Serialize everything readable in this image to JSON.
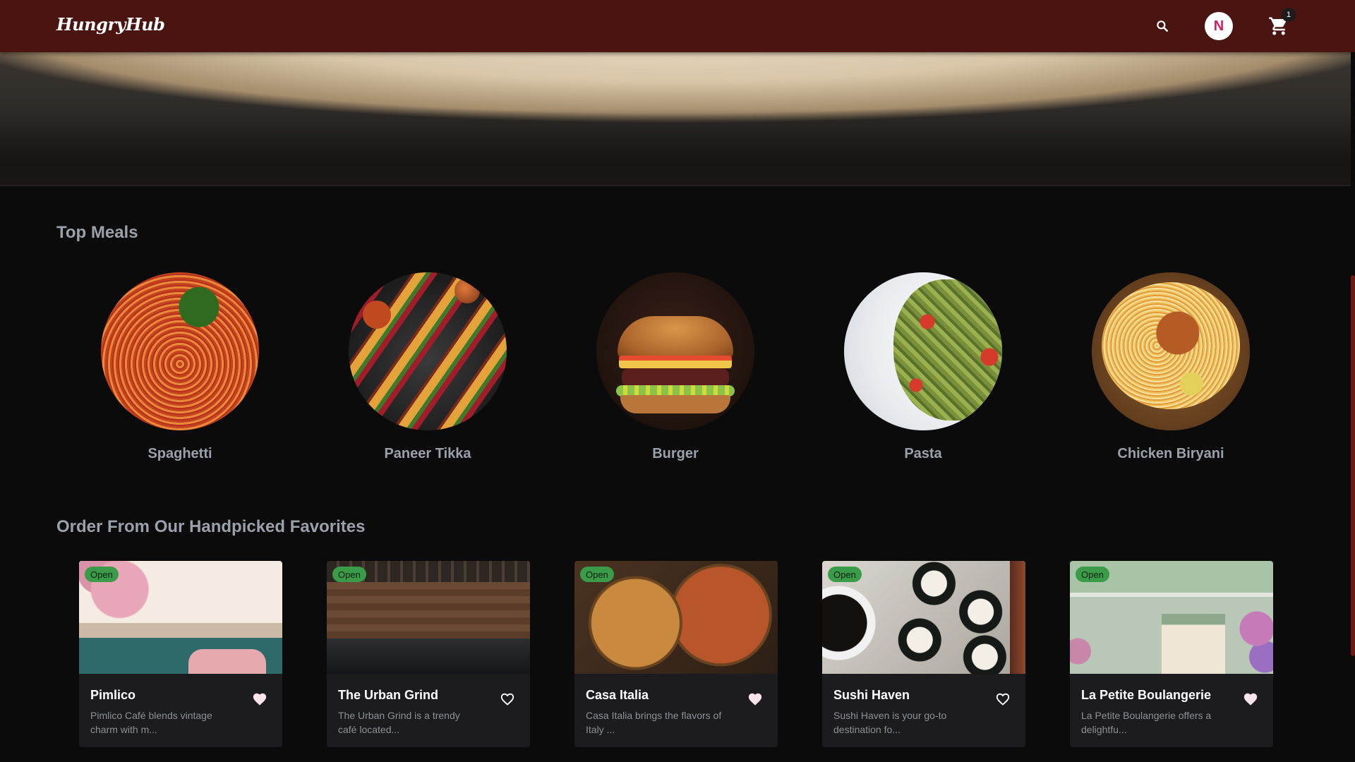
{
  "header": {
    "logo_text": "HungryHub",
    "avatar_initial": "N",
    "cart_count": "1",
    "icons": {
      "search": "search-icon",
      "cart": "cart-icon"
    },
    "colors": {
      "bar": "#4a1510",
      "avatar_text": "#d81b60"
    }
  },
  "sections": {
    "top_meals_title": "Top Meals",
    "favorites_title": "Order From Our Handpicked Favorites"
  },
  "meals": [
    {
      "name": "Spaghetti"
    },
    {
      "name": "Paneer Tikka"
    },
    {
      "name": "Burger"
    },
    {
      "name": "Pasta"
    },
    {
      "name": "Chicken Biryani"
    }
  ],
  "restaurants": [
    {
      "name": "Pimlico",
      "status": "Open",
      "description": "Pimlico Café blends vintage charm with m...",
      "favorite_icon": "heart-filled-icon"
    },
    {
      "name": "The Urban Grind",
      "status": "Open",
      "description": "The Urban Grind is a trendy café located...",
      "favorite_icon": "heart-outline-icon"
    },
    {
      "name": "Casa Italia",
      "status": "Open",
      "description": "Casa Italia brings the flavors of Italy ...",
      "favorite_icon": "heart-filled-icon"
    },
    {
      "name": "Sushi Haven",
      "status": "Open",
      "description": "Sushi Haven is your go-to destination fo...",
      "favorite_icon": "heart-outline-icon"
    },
    {
      "name": "La Petite Boulangerie",
      "status": "Open",
      "description": "La Petite Boulangerie offers a delightfu...",
      "favorite_icon": "heart-filled-icon"
    }
  ],
  "colors": {
    "page_bg": "#0b0b0c",
    "section_title": "#9aa1ab",
    "card_bg": "#1c1c1e",
    "open_badge": "#3a9b48"
  }
}
